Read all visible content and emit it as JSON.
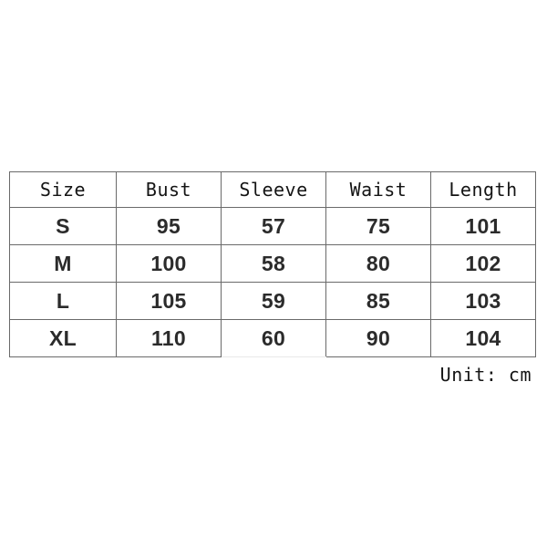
{
  "table": {
    "headers": [
      "Size",
      "Bust",
      "Sleeve",
      "Waist",
      "Length"
    ],
    "rows": [
      {
        "size": "S",
        "bust": "95",
        "sleeve": "57",
        "waist": "75",
        "length": "101"
      },
      {
        "size": "M",
        "bust": "100",
        "sleeve": "58",
        "waist": "80",
        "length": "102"
      },
      {
        "size": "L",
        "bust": "105",
        "sleeve": "59",
        "waist": "85",
        "length": "103"
      },
      {
        "size": "XL",
        "bust": "110",
        "sleeve": "60",
        "waist": "90",
        "length": "104"
      }
    ]
  },
  "unit_note": "Unit: cm",
  "colors": {
    "background": "#ffffff",
    "border": "#6a6a6a",
    "header_text": "#141414",
    "cell_text": "#2b2b2b"
  }
}
